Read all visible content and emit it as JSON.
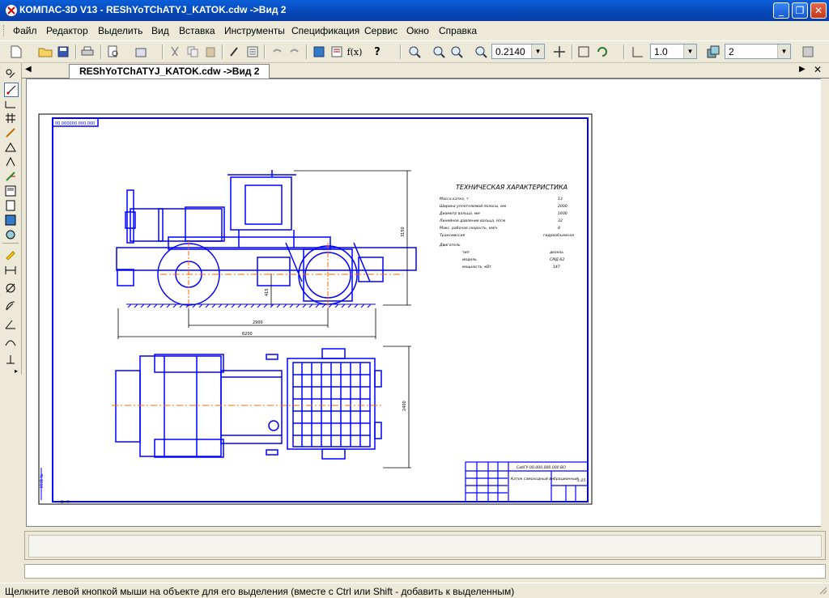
{
  "window": {
    "title": "КОМПАС-3D V13 - REShYoTChATYJ_KATOK.cdw ->Вид 2"
  },
  "menu": [
    "Файл",
    "Редактор",
    "Выделить",
    "Вид",
    "Вставка",
    "Инструменты",
    "Спецификация",
    "Сервис",
    "Окно",
    "Справка"
  ],
  "toolbar": {
    "zoom_value": "0.2140",
    "step_value": "1.0",
    "layer_value": "2"
  },
  "document_tab": {
    "label": "REShYoTChATYJ_KATOK.cdw ->Вид 2"
  },
  "drawing": {
    "stamp_top_left": "00.000000.000.000",
    "spec_title": "ТЕХНИЧЕСКАЯ ХАРАКТЕРИСТИКА",
    "spec_rows": [
      {
        "label": "Масса катка, т",
        "value": "13"
      },
      {
        "label": "Ширина уплотняемой полосы, мм",
        "value": "2000"
      },
      {
        "label": "Диаметр вальца, мм",
        "value": "1600"
      },
      {
        "label": "Линейное давление вальца, Н/см",
        "value": "32"
      },
      {
        "label": "Макс. рабочая скорость, км/ч",
        "value": "8"
      },
      {
        "label": "Трансмиссия",
        "value": "гидрообъемная"
      }
    ],
    "engine_header": "Двигатель",
    "engine_rows": [
      {
        "label": "тип",
        "value": "дизель"
      },
      {
        "label": "модель",
        "value": "СМД-62"
      },
      {
        "label": "мощность, кВт",
        "value": "147"
      }
    ],
    "dim_height": "3150",
    "dim_length_inner": "2900",
    "dim_length_total": "6200",
    "dim_width": "2400",
    "dim_small": "415",
    "title_block_code": "СибГУ-00.000.000.000 ВО",
    "title_block_name": "Каток самоходный вибрационный",
    "title_block_sheet": "1:25",
    "origin_label": "0=Y"
  },
  "status": {
    "hint": "Щелкните левой кнопкой мыши на объекте для его выделения (вместе с Ctrl или Shift - добавить к выделенным)"
  },
  "colors": {
    "drawing_line": "#0000ff",
    "axis_line": "#ff6600",
    "titlebar": "#0a5fd8"
  }
}
